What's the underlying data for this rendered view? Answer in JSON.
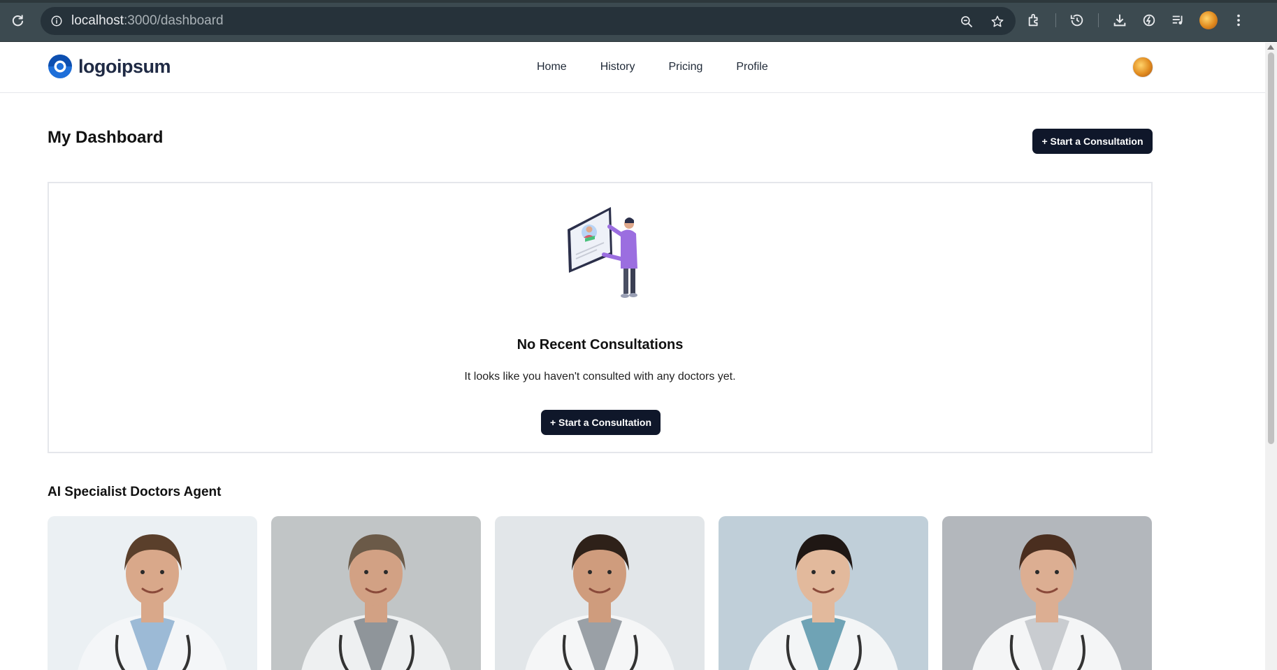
{
  "browser": {
    "url_host": "localhost",
    "url_path": ":3000/dashboard"
  },
  "navbar": {
    "logo_text": "logoipsum",
    "links": [
      "Home",
      "History",
      "Pricing",
      "Profile"
    ]
  },
  "dashboard": {
    "title": "My Dashboard",
    "start_button": "+ Start a Consultation"
  },
  "empty_state": {
    "title": "No Recent Consultations",
    "subtitle": "It looks like you haven't consulted with any doctors yet.",
    "button": "+ Start a Consultation"
  },
  "specialists": {
    "title": "AI Specialist Doctors Agent",
    "cards": [
      {
        "bg": "#e9eef2",
        "coat": "#f4f6f8",
        "shirt": "#9cbad6",
        "hair": "#5a3f2b",
        "skin": "#d9a88a"
      },
      {
        "bg": "#b9bdbf",
        "coat": "#eef0f1",
        "shirt": "#8f959a",
        "hair": "#6b5a48",
        "skin": "#d2a184"
      },
      {
        "bg": "#dfe3e6",
        "coat": "#f5f6f7",
        "shirt": "#9aa0a6",
        "hair": "#2e2119",
        "skin": "#cf9c7d"
      },
      {
        "bg": "#b8c9d4",
        "coat": "#f3f5f6",
        "shirt": "#6fa3b5",
        "hair": "#1f1714",
        "skin": "#e2b99c"
      },
      {
        "bg": "#a9adb3",
        "coat": "#f4f5f6",
        "shirt": "#c9ccd0",
        "hair": "#4a2e1f",
        "skin": "#dcae92"
      }
    ]
  },
  "colors": {
    "primary_dark": "#0f172a",
    "logo_blue": "#1e6fd9",
    "border": "#e5e7eb"
  }
}
